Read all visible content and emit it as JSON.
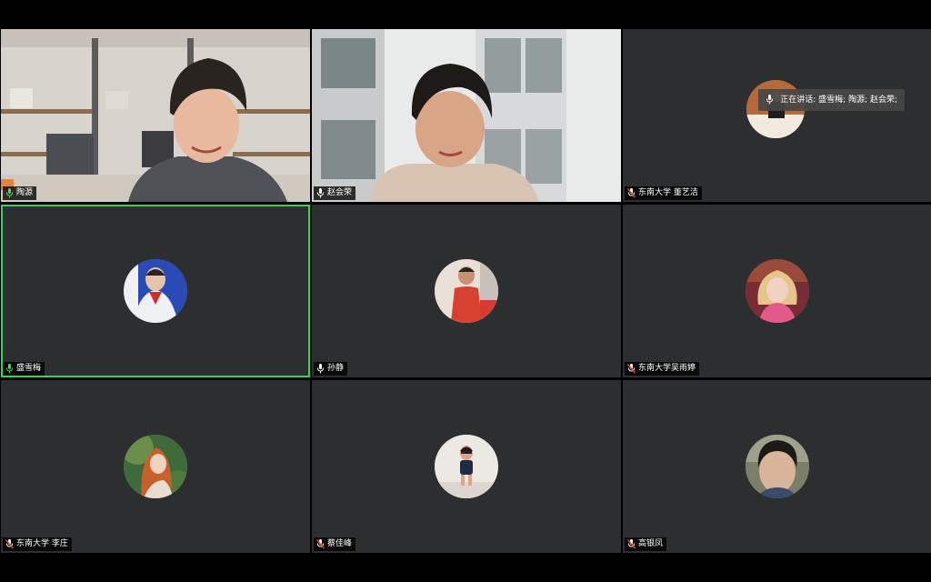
{
  "participants": [
    {
      "name": "陶源",
      "mic": "muted-active",
      "has_video": true
    },
    {
      "name": "赵会荣",
      "mic": "on",
      "has_video": true
    },
    {
      "name": "东南大学 董艺洁",
      "mic": "muted",
      "has_video": false
    },
    {
      "name": "盛雪梅",
      "mic": "speaking",
      "has_video": false,
      "active_speaker": true
    },
    {
      "name": "孙静",
      "mic": "on",
      "has_video": false
    },
    {
      "name": "东南大学吴雨婷",
      "mic": "muted",
      "has_video": false
    },
    {
      "name": "东南大学 李庄",
      "mic": "muted",
      "has_video": false
    },
    {
      "name": "蔡佳峰",
      "mic": "muted",
      "has_video": false
    },
    {
      "name": "高银凤",
      "mic": "muted",
      "has_video": false
    }
  ],
  "speaking_banner": {
    "text": "正在讲话: 盛雪梅; 陶源; 赵会荣;"
  },
  "colors": {
    "tile_bg": "#2d2e30",
    "active_border": "#3ccf5b",
    "muted_red": "#e24d3c"
  }
}
